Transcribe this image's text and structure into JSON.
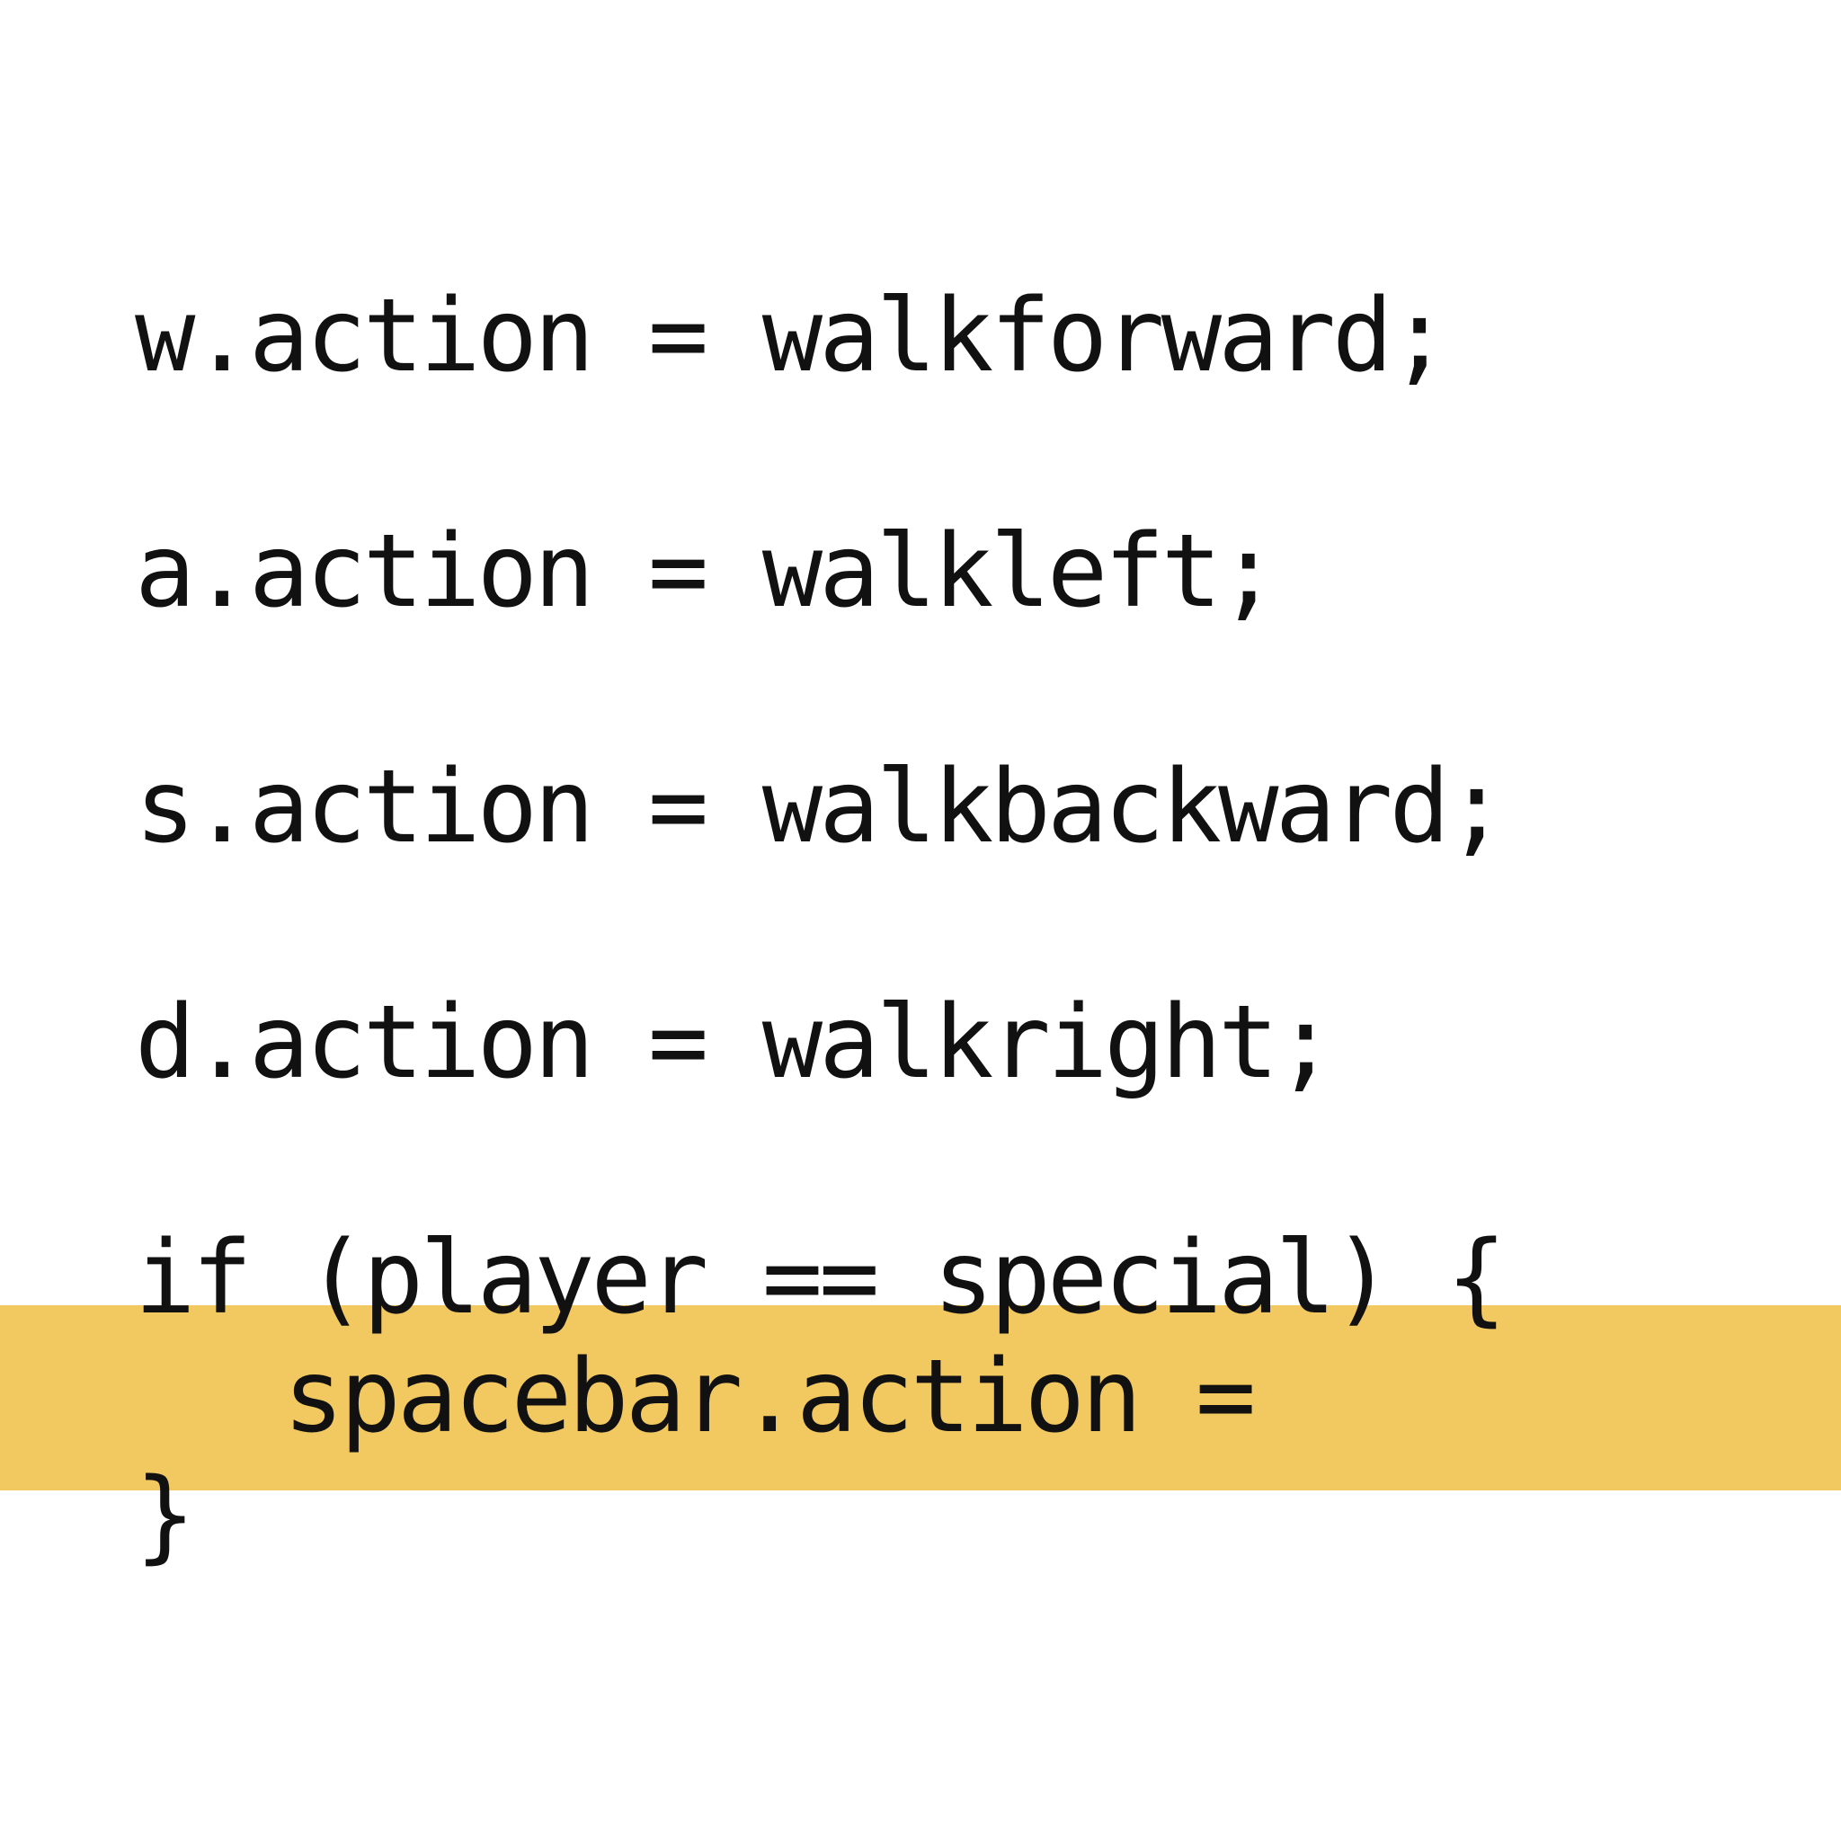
{
  "colors": {
    "background": "#ffffff",
    "text": "#111111",
    "highlight": "#f2c860"
  },
  "code": {
    "lines": [
      "w.action = walkforward;",
      "a.action = walkleft;",
      "s.action = walkbackward;",
      "d.action = walkright;",
      "if (player == special) {",
      "spacebar.action =",
      "}"
    ]
  }
}
